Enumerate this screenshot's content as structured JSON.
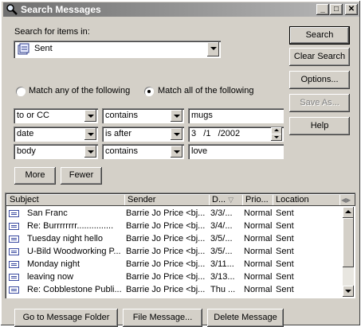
{
  "window": {
    "title": "Search Messages",
    "controls": {
      "minimize": "_",
      "maximize": "□",
      "close": "✕"
    }
  },
  "search_in": {
    "label": "Search for items in:",
    "folder": "Sent",
    "folder_icon": "sent-folder-icon"
  },
  "buttons": {
    "search": "Search",
    "clear_search": "Clear Search",
    "options": "Options...",
    "save_as": "Save As...",
    "help": "Help",
    "more": "More",
    "fewer": "Fewer",
    "go_to_folder": "Go to Message Folder",
    "file_message": "File Message...",
    "delete_message": "Delete Message"
  },
  "match": {
    "any_label": "Match any of the following",
    "all_label": "Match all of the following",
    "selected": "all"
  },
  "criteria": [
    {
      "field": "to or CC",
      "operator": "contains",
      "value": "mugs"
    },
    {
      "field": "date",
      "operator": "is after",
      "value": "3   /1   /2002"
    },
    {
      "field": "body",
      "operator": "contains",
      "value": "love"
    }
  ],
  "results": {
    "columns": [
      "Subject",
      "Sender",
      "D...",
      "Prio...",
      "Location"
    ],
    "rows": [
      {
        "subject": "San Franc",
        "sender": "Barrie Jo Price <bj...",
        "date": "3/3/...",
        "priority": "Normal",
        "location": "Sent"
      },
      {
        "subject": "Re: Burrrrrrrr...............",
        "sender": "Barrie Jo Price <bj...",
        "date": "3/4/...",
        "priority": "Normal",
        "location": "Sent"
      },
      {
        "subject": "Tuesday night hello",
        "sender": "Barrie Jo Price <bj...",
        "date": "3/5/...",
        "priority": "Normal",
        "location": "Sent"
      },
      {
        "subject": "U-Bild Woodworking P...",
        "sender": "Barrie Jo Price <bj...",
        "date": "3/5/...",
        "priority": "Normal",
        "location": "Sent"
      },
      {
        "subject": "Monday night",
        "sender": "Barrie Jo Price <bj...",
        "date": "3/11...",
        "priority": "Normal",
        "location": "Sent"
      },
      {
        "subject": "leaving now",
        "sender": "Barrie Jo Price <bj...",
        "date": "3/13...",
        "priority": "Normal",
        "location": "Sent"
      },
      {
        "subject": "Re: Cobblestone Publi...",
        "sender": "Barrie Jo Price <bj...",
        "date": "Thu ...",
        "priority": "Normal",
        "location": "Sent"
      }
    ]
  }
}
